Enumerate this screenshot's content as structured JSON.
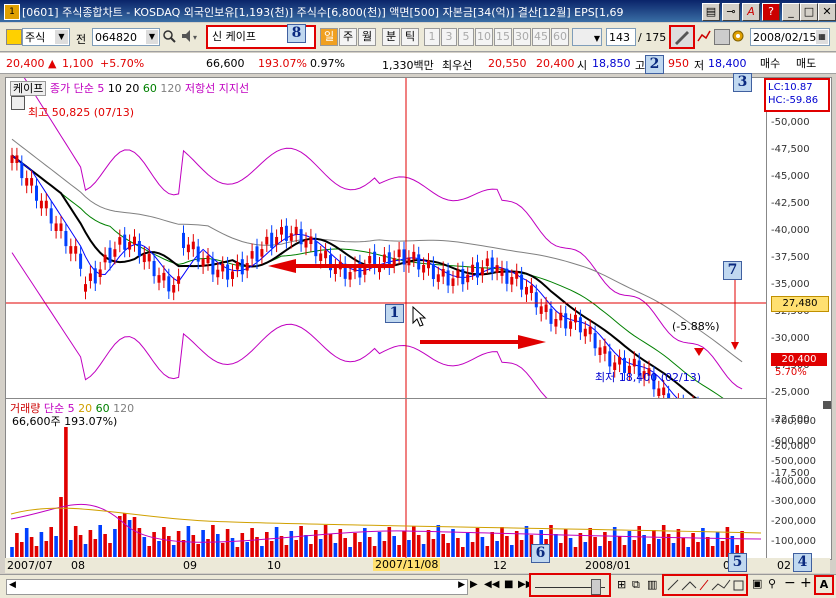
{
  "window": {
    "title": "[0601] 주식종합차트 - KOSDAQ 외국인보유[1,193(천)] 주식수[6,800(천)] 액면[500] 자본금[34(억)] 결산[12월] EPS[1,69",
    "app_icon": "1",
    "buttons": [
      "print-icon",
      "pin-icon",
      "A",
      "?",
      "minimize-icon",
      "maximize-icon",
      "close-icon"
    ]
  },
  "toolbar": {
    "market": "주식",
    "jeon": "전",
    "code": "064820",
    "name_prefix": "신",
    "name": "케이프",
    "period_buttons": [
      "일",
      "주",
      "월",
      "분",
      "틱"
    ],
    "minute_buttons": [
      "1",
      "3",
      "5",
      "10",
      "15",
      "30",
      "45",
      "60"
    ],
    "count": "143",
    "total": "/ 175",
    "date": "2008/02/15"
  },
  "info": {
    "price": "20,400",
    "change_arrow": "▲",
    "change": "1,100",
    "change_pct": "+5.70%",
    "volume": "66,600",
    "vol_ratio": "193.07%",
    "turnover": "0.97%",
    "amount": "1,330백만",
    "best_ask_label": "최우선",
    "best_ask": "20,550",
    "best_bid": "20,400",
    "open_label": "시",
    "open": "18,850",
    "high_label": "고",
    "high": "950",
    "low_label": "저",
    "low": "18,400",
    "buy": "매수",
    "sell": "매도"
  },
  "price_panel": {
    "legend": [
      "케이프",
      "종가 단순 5",
      "10",
      "20",
      "60",
      "120",
      "저항선",
      "지지선"
    ],
    "high_note": "최고 50,825 (07/13)",
    "low_note": "최저 18,400 (02/13)",
    "pct_note": "(-5.88%)",
    "lc": "LC:10.87",
    "hc": "HC:-59.86",
    "crosshair_price": "27,480",
    "current_price": "20,400",
    "current_pct": "5.70%"
  },
  "y_ticks": [
    "50,000",
    "47,500",
    "45,000",
    "42,500",
    "40,000",
    "37,500",
    "35,000",
    "32,500",
    "30,000",
    "27,500",
    "25,000",
    "22,500",
    "20,000",
    "17,500"
  ],
  "vol_panel": {
    "legend": [
      "거래량",
      "단순 5",
      "20",
      "60",
      "120"
    ],
    "note": "66,600주 193.07%)"
  },
  "vol_ticks": [
    "700,000",
    "600,000",
    "500,000",
    "400,000",
    "300,000",
    "200,000",
    "100,000"
  ],
  "dates": [
    "2007/07",
    "08",
    "09",
    "10",
    "2007/11/08",
    "12",
    "2008/01",
    "02",
    "02"
  ],
  "callouts": [
    "1",
    "2",
    "3",
    "4",
    "5",
    "6",
    "7",
    "8"
  ],
  "colors": {
    "up": "#e00000",
    "down": "#0040ff",
    "ma5": "#0000ff",
    "ma10": "#000000",
    "ma20": "#008000",
    "ma60": "#808080",
    "bands": "#c000c0",
    "arrow": "#e00000"
  }
}
